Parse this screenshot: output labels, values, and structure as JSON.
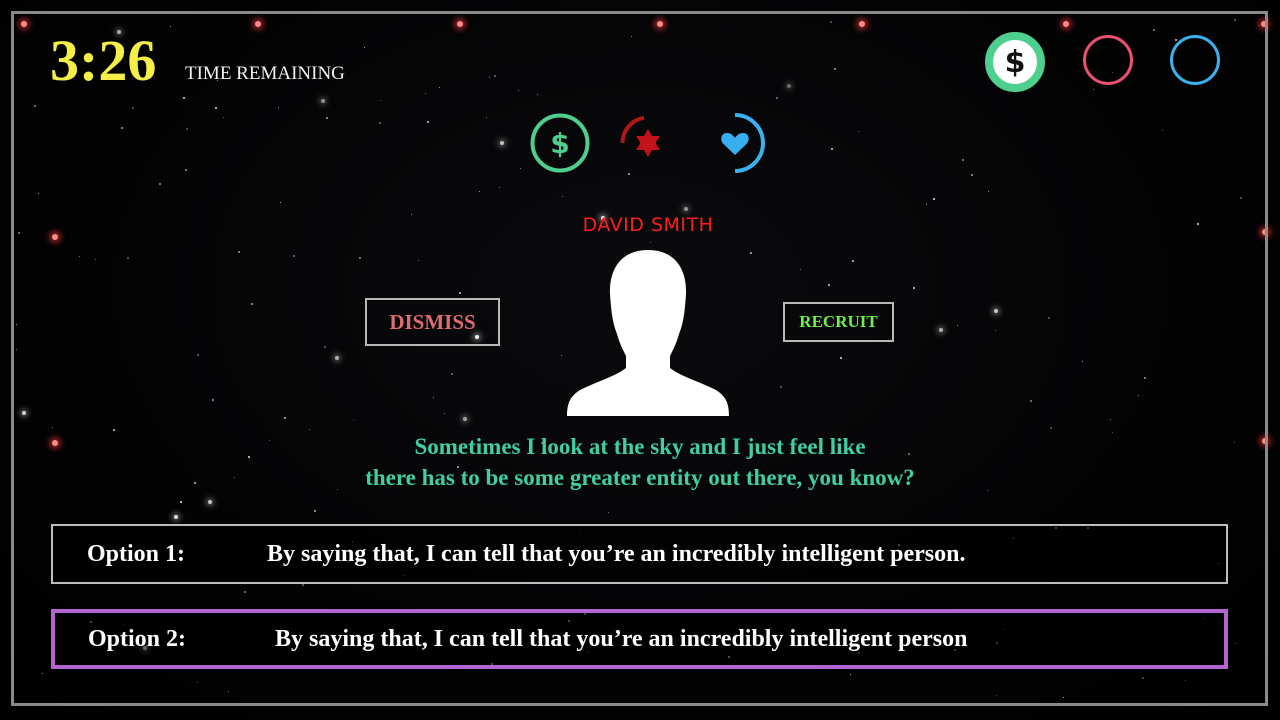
{
  "hud": {
    "timer_value": "3:26",
    "timer_label": "TIME REMAINING",
    "top_icons": [
      "dollar-coin-icon",
      "red-ring-icon",
      "blue-ring-icon"
    ],
    "colors": {
      "timer": "#f4ef46",
      "money": "#4fcf8e",
      "faith": "#e8506e",
      "loyalty": "#3bb0ee"
    }
  },
  "stats": {
    "icons": [
      "dollar-stat-icon",
      "star-stat-icon",
      "heart-stat-icon"
    ],
    "money_level": 1.0,
    "star_level": 0.3,
    "heart_level": 0.55
  },
  "npc": {
    "name": "DAVID SMITH",
    "avatar_icon": "person-silhouette-icon",
    "dialogue_line1": "Sometimes I look at the sky and I just feel like",
    "dialogue_line2": "there has to be some greater entity out there, you know?"
  },
  "actions": {
    "dismiss_label": "DISMISS",
    "recruit_label": "RECRUIT"
  },
  "options": [
    {
      "label": "Option 1:",
      "text": "By saying that, I can tell that you’re an incredibly intelligent person."
    },
    {
      "label": "Option 2:",
      "text": "By saying that, I can tell that you’re an incredibly intelligent person"
    }
  ]
}
